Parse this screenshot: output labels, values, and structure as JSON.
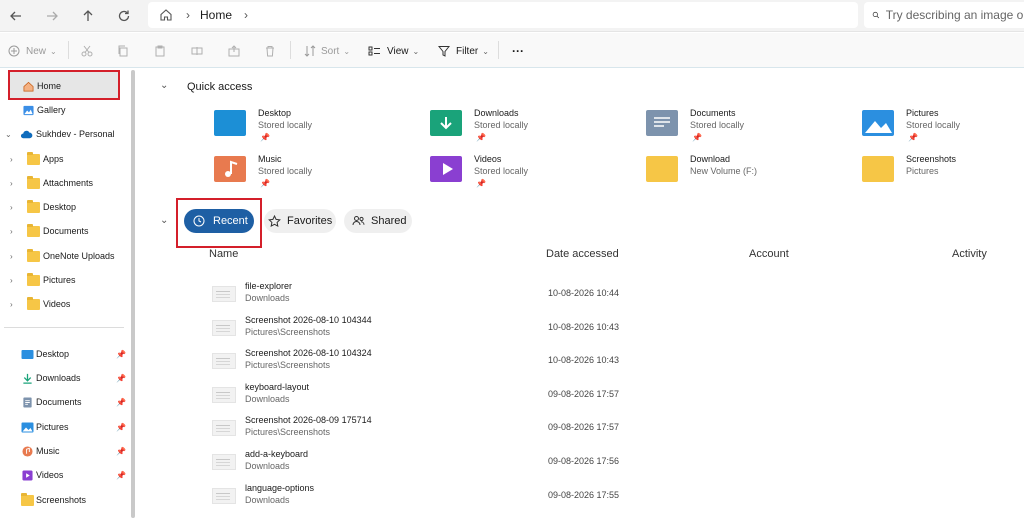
{
  "nav": {
    "back_icon": "arrow-left-icon",
    "forward_icon": "arrow-right-icon",
    "up_icon": "arrow-up-icon",
    "refresh_icon": "refresh-icon",
    "breadcrumb": "Home",
    "search_placeholder": "Try describing an image or f"
  },
  "toolbar": {
    "new_label": "New",
    "sort_label": "Sort",
    "view_label": "View",
    "filter_label": "Filter",
    "more_label": "···"
  },
  "sidebar": {
    "top": [
      {
        "label": "Home"
      },
      {
        "label": "Gallery"
      },
      {
        "label": "Sukhdev - Personal"
      }
    ],
    "folders": [
      {
        "label": "Apps"
      },
      {
        "label": "Attachments"
      },
      {
        "label": "Desktop"
      },
      {
        "label": "Documents"
      },
      {
        "label": "OneNote Uploads"
      },
      {
        "label": "Pictures"
      },
      {
        "label": "Videos"
      }
    ],
    "pinned": [
      {
        "label": "Desktop"
      },
      {
        "label": "Downloads"
      },
      {
        "label": "Documents"
      },
      {
        "label": "Pictures"
      },
      {
        "label": "Music"
      },
      {
        "label": "Videos"
      },
      {
        "label": "Screenshots"
      }
    ]
  },
  "quick_access": {
    "title": "Quick access",
    "items": [
      {
        "name": "Desktop",
        "sub": "Stored locally",
        "color": "#1c8fd6"
      },
      {
        "name": "Downloads",
        "sub": "Stored locally",
        "color": "#1aa37a"
      },
      {
        "name": "Documents",
        "sub": "Stored locally",
        "color": "#7d93ad"
      },
      {
        "name": "Pictures",
        "sub": "Stored locally",
        "color": "#2b8fe0"
      },
      {
        "name": "Music",
        "sub": "Stored locally",
        "color": "#e87a4f"
      },
      {
        "name": "Videos",
        "sub": "Stored locally",
        "color": "#8a3fd1"
      },
      {
        "name": "Download",
        "sub": "New Volume (F:)",
        "color": "#f6c646"
      },
      {
        "name": "Screenshots",
        "sub": "Pictures",
        "color": "#f6c646"
      }
    ]
  },
  "tabs": {
    "recent": "Recent",
    "favorites": "Favorites",
    "shared": "Shared"
  },
  "columns": {
    "name": "Name",
    "date": "Date accessed",
    "account": "Account",
    "activity": "Activity"
  },
  "recent_files": [
    {
      "name": "file-explorer",
      "location": "Downloads",
      "date": "10-08-2026 10:44"
    },
    {
      "name": "Screenshot 2026-08-10 104344",
      "location": "Pictures\\Screenshots",
      "date": "10-08-2026 10:43"
    },
    {
      "name": "Screenshot 2026-08-10 104324",
      "location": "Pictures\\Screenshots",
      "date": "10-08-2026 10:43"
    },
    {
      "name": "keyboard-layout",
      "location": "Downloads",
      "date": "09-08-2026 17:57"
    },
    {
      "name": "Screenshot 2026-08-09 175714",
      "location": "Pictures\\Screenshots",
      "date": "09-08-2026 17:57"
    },
    {
      "name": "add-a-keyboard",
      "location": "Downloads",
      "date": "09-08-2026 17:56"
    },
    {
      "name": "language-options",
      "location": "Downloads",
      "date": "09-08-2026 17:55"
    }
  ],
  "colors": {
    "accent": "#1e5fa4",
    "highlight_border": "#d41f2a",
    "folder_yellow": "#f6c646"
  }
}
